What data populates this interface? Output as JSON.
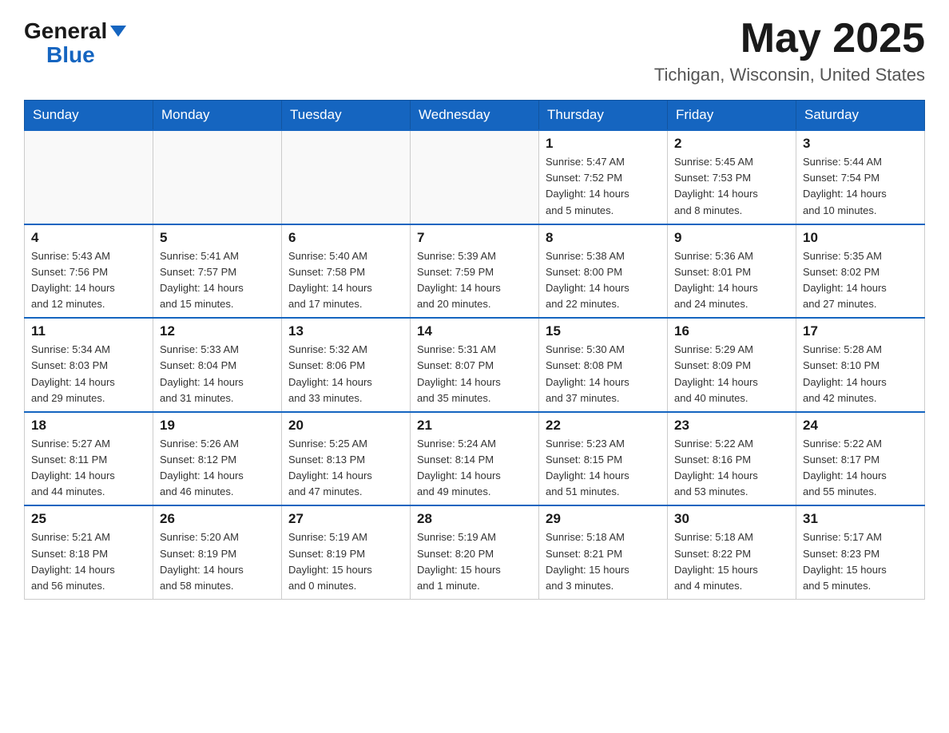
{
  "header": {
    "logo_general": "General",
    "logo_blue": "Blue",
    "month_year": "May 2025",
    "location": "Tichigan, Wisconsin, United States"
  },
  "days_of_week": [
    "Sunday",
    "Monday",
    "Tuesday",
    "Wednesday",
    "Thursday",
    "Friday",
    "Saturday"
  ],
  "weeks": [
    [
      {
        "day": "",
        "info": ""
      },
      {
        "day": "",
        "info": ""
      },
      {
        "day": "",
        "info": ""
      },
      {
        "day": "",
        "info": ""
      },
      {
        "day": "1",
        "info": "Sunrise: 5:47 AM\nSunset: 7:52 PM\nDaylight: 14 hours\nand 5 minutes."
      },
      {
        "day": "2",
        "info": "Sunrise: 5:45 AM\nSunset: 7:53 PM\nDaylight: 14 hours\nand 8 minutes."
      },
      {
        "day": "3",
        "info": "Sunrise: 5:44 AM\nSunset: 7:54 PM\nDaylight: 14 hours\nand 10 minutes."
      }
    ],
    [
      {
        "day": "4",
        "info": "Sunrise: 5:43 AM\nSunset: 7:56 PM\nDaylight: 14 hours\nand 12 minutes."
      },
      {
        "day": "5",
        "info": "Sunrise: 5:41 AM\nSunset: 7:57 PM\nDaylight: 14 hours\nand 15 minutes."
      },
      {
        "day": "6",
        "info": "Sunrise: 5:40 AM\nSunset: 7:58 PM\nDaylight: 14 hours\nand 17 minutes."
      },
      {
        "day": "7",
        "info": "Sunrise: 5:39 AM\nSunset: 7:59 PM\nDaylight: 14 hours\nand 20 minutes."
      },
      {
        "day": "8",
        "info": "Sunrise: 5:38 AM\nSunset: 8:00 PM\nDaylight: 14 hours\nand 22 minutes."
      },
      {
        "day": "9",
        "info": "Sunrise: 5:36 AM\nSunset: 8:01 PM\nDaylight: 14 hours\nand 24 minutes."
      },
      {
        "day": "10",
        "info": "Sunrise: 5:35 AM\nSunset: 8:02 PM\nDaylight: 14 hours\nand 27 minutes."
      }
    ],
    [
      {
        "day": "11",
        "info": "Sunrise: 5:34 AM\nSunset: 8:03 PM\nDaylight: 14 hours\nand 29 minutes."
      },
      {
        "day": "12",
        "info": "Sunrise: 5:33 AM\nSunset: 8:04 PM\nDaylight: 14 hours\nand 31 minutes."
      },
      {
        "day": "13",
        "info": "Sunrise: 5:32 AM\nSunset: 8:06 PM\nDaylight: 14 hours\nand 33 minutes."
      },
      {
        "day": "14",
        "info": "Sunrise: 5:31 AM\nSunset: 8:07 PM\nDaylight: 14 hours\nand 35 minutes."
      },
      {
        "day": "15",
        "info": "Sunrise: 5:30 AM\nSunset: 8:08 PM\nDaylight: 14 hours\nand 37 minutes."
      },
      {
        "day": "16",
        "info": "Sunrise: 5:29 AM\nSunset: 8:09 PM\nDaylight: 14 hours\nand 40 minutes."
      },
      {
        "day": "17",
        "info": "Sunrise: 5:28 AM\nSunset: 8:10 PM\nDaylight: 14 hours\nand 42 minutes."
      }
    ],
    [
      {
        "day": "18",
        "info": "Sunrise: 5:27 AM\nSunset: 8:11 PM\nDaylight: 14 hours\nand 44 minutes."
      },
      {
        "day": "19",
        "info": "Sunrise: 5:26 AM\nSunset: 8:12 PM\nDaylight: 14 hours\nand 46 minutes."
      },
      {
        "day": "20",
        "info": "Sunrise: 5:25 AM\nSunset: 8:13 PM\nDaylight: 14 hours\nand 47 minutes."
      },
      {
        "day": "21",
        "info": "Sunrise: 5:24 AM\nSunset: 8:14 PM\nDaylight: 14 hours\nand 49 minutes."
      },
      {
        "day": "22",
        "info": "Sunrise: 5:23 AM\nSunset: 8:15 PM\nDaylight: 14 hours\nand 51 minutes."
      },
      {
        "day": "23",
        "info": "Sunrise: 5:22 AM\nSunset: 8:16 PM\nDaylight: 14 hours\nand 53 minutes."
      },
      {
        "day": "24",
        "info": "Sunrise: 5:22 AM\nSunset: 8:17 PM\nDaylight: 14 hours\nand 55 minutes."
      }
    ],
    [
      {
        "day": "25",
        "info": "Sunrise: 5:21 AM\nSunset: 8:18 PM\nDaylight: 14 hours\nand 56 minutes."
      },
      {
        "day": "26",
        "info": "Sunrise: 5:20 AM\nSunset: 8:19 PM\nDaylight: 14 hours\nand 58 minutes."
      },
      {
        "day": "27",
        "info": "Sunrise: 5:19 AM\nSunset: 8:19 PM\nDaylight: 15 hours\nand 0 minutes."
      },
      {
        "day": "28",
        "info": "Sunrise: 5:19 AM\nSunset: 8:20 PM\nDaylight: 15 hours\nand 1 minute."
      },
      {
        "day": "29",
        "info": "Sunrise: 5:18 AM\nSunset: 8:21 PM\nDaylight: 15 hours\nand 3 minutes."
      },
      {
        "day": "30",
        "info": "Sunrise: 5:18 AM\nSunset: 8:22 PM\nDaylight: 15 hours\nand 4 minutes."
      },
      {
        "day": "31",
        "info": "Sunrise: 5:17 AM\nSunset: 8:23 PM\nDaylight: 15 hours\nand 5 minutes."
      }
    ]
  ]
}
